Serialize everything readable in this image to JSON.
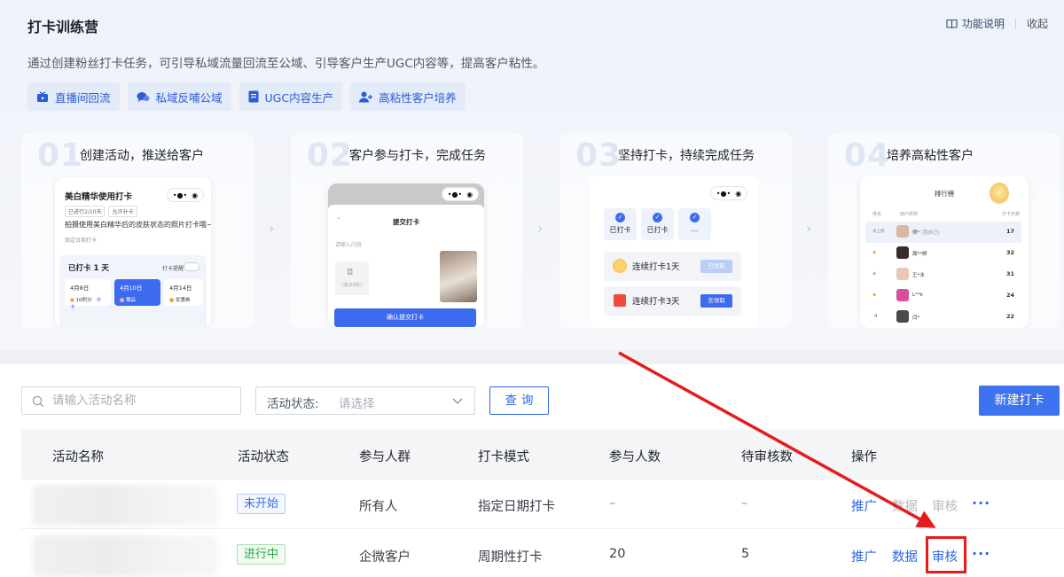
{
  "header": {
    "title": "打卡训练营",
    "help_label": "功能说明",
    "collapse_label": "收起",
    "description": "通过创建粉丝打卡任务，可引导私域流量回流至公域、引导客户生产UGC内容等，提高客户粘性。"
  },
  "tags": [
    {
      "label": "直播间回流",
      "icon": "live-icon"
    },
    {
      "label": "私域反哺公域",
      "icon": "chat-icon"
    },
    {
      "label": "UGC内容生产",
      "icon": "ugc-icon"
    },
    {
      "label": "高粘性客户培养",
      "icon": "user-add-icon"
    }
  ],
  "steps": [
    {
      "num": "01",
      "title": "创建活动，推送给客户"
    },
    {
      "num": "02",
      "title": "客户参与打卡，完成任务"
    },
    {
      "num": "03",
      "title": "坚持打卡，持续完成任务"
    },
    {
      "num": "04",
      "title": "培养高粘性客户"
    }
  ],
  "step1_preview": {
    "title": "美白精华使用打卡",
    "chips": [
      "已进行2/10天",
      "允许补卡"
    ],
    "text": "拍摄使用美白精华后的皮肤状态的照片打卡哦~",
    "sub": "指定日期打卡",
    "card_title": "已打卡 1 天",
    "reminder": "打卡提醒",
    "days": [
      {
        "date": "4月8日",
        "note": "10积分",
        "extra": "补卡"
      },
      {
        "date": "4月10日",
        "note": "赠品",
        "extra": ""
      },
      {
        "date": "4月14日",
        "note": "优惠券",
        "extra": ""
      }
    ]
  },
  "step2_preview": {
    "title": "提交打卡",
    "placeholder": "请输入内容",
    "add_hint": "(最多9张)",
    "submit": "确认提交打卡"
  },
  "step3_preview": {
    "checks": [
      "已打卡",
      "已打卡",
      "..."
    ],
    "rewards": [
      {
        "text": "连续打卡1天",
        "button": "已领取"
      },
      {
        "text": "连续打卡3天",
        "button": "去领取"
      }
    ]
  },
  "step4_preview": {
    "title": "排行榜",
    "headers": [
      "排名",
      "用户昵称",
      "打卡天数"
    ],
    "rows": [
      {
        "rank": "未上榜",
        "name": "师*",
        "note": "(我自己)",
        "score": "17"
      },
      {
        "rank": "",
        "name": "周**婷",
        "note": "",
        "score": "32"
      },
      {
        "rank": "",
        "name": "王*冰",
        "note": "",
        "score": "31"
      },
      {
        "rank": "",
        "name": "L**k",
        "note": "",
        "score": "24"
      },
      {
        "rank": "4",
        "name": "闫*",
        "note": "",
        "score": "22"
      }
    ]
  },
  "filters": {
    "search_placeholder": "请输入活动名称",
    "status_label": "活动状态:",
    "status_placeholder": "请选择",
    "query_label": "查询",
    "new_label": "新建打卡"
  },
  "table": {
    "headers": [
      "活动名称",
      "活动状态",
      "参与人群",
      "打卡模式",
      "参与人数",
      "待审核数",
      "操作"
    ],
    "rows": [
      {
        "name": "",
        "status": "未开始",
        "audience": "所有人",
        "mode": "指定日期打卡",
        "participants": "–",
        "pending": "–",
        "ops": [
          "推广",
          "数据",
          "审核"
        ],
        "more": "···"
      },
      {
        "name": "",
        "status": "进行中",
        "audience": "企微客户",
        "mode": "周期性打卡",
        "participants": "20",
        "pending": "5",
        "ops": [
          "推广",
          "数据",
          "审核"
        ],
        "more": "···"
      }
    ]
  },
  "colors": {
    "primary": "#2e67e8",
    "annotation_red": "#e51c1c",
    "status_not_started": "#3d6fe0",
    "status_running": "#27a745"
  }
}
